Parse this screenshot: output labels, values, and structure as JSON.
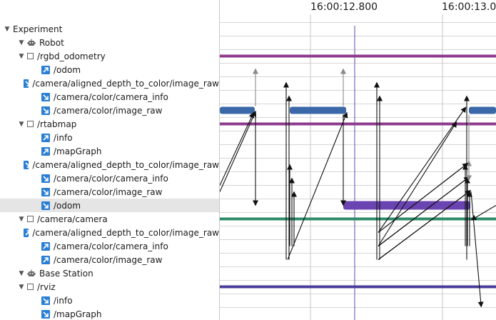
{
  "tree": [
    {
      "label": "Experiment",
      "kind": "group",
      "depth": 0
    },
    {
      "label": "Robot",
      "kind": "robot",
      "depth": 1
    },
    {
      "label": "/rgbd_odometry",
      "kind": "node",
      "depth": 2
    },
    {
      "label": "/odom",
      "kind": "pub",
      "depth": 3
    },
    {
      "label": "/camera/aligned_depth_to_color/image_raw",
      "kind": "sub",
      "depth": 3
    },
    {
      "label": "/camera/color/camera_info",
      "kind": "sub",
      "depth": 3
    },
    {
      "label": "/camera/color/image_raw",
      "kind": "sub",
      "depth": 3
    },
    {
      "label": "/rtabmap",
      "kind": "node",
      "depth": 2
    },
    {
      "label": "/info",
      "kind": "pub",
      "depth": 3
    },
    {
      "label": "/mapGraph",
      "kind": "pub",
      "depth": 3
    },
    {
      "label": "/camera/aligned_depth_to_color/image_raw",
      "kind": "sub",
      "depth": 3
    },
    {
      "label": "/camera/color/camera_info",
      "kind": "sub",
      "depth": 3
    },
    {
      "label": "/camera/color/image_raw",
      "kind": "sub",
      "depth": 3
    },
    {
      "label": "/odom",
      "kind": "sub",
      "depth": 3,
      "selected": true
    },
    {
      "label": "/camera/camera",
      "kind": "node",
      "depth": 2
    },
    {
      "label": "/camera/aligned_depth_to_color/image_raw",
      "kind": "pub",
      "depth": 3
    },
    {
      "label": "/camera/color/camera_info",
      "kind": "pub",
      "depth": 3
    },
    {
      "label": "/camera/color/image_raw",
      "kind": "pub",
      "depth": 3
    },
    {
      "label": "Base Station",
      "kind": "robot",
      "depth": 1
    },
    {
      "label": "/rviz",
      "kind": "node",
      "depth": 2
    },
    {
      "label": "/info",
      "kind": "sub",
      "depth": 3
    },
    {
      "label": "/mapGraph",
      "kind": "sub",
      "depth": 3
    }
  ],
  "timeline": {
    "ticks": [
      "16:00:12.800",
      "16:00:13.0"
    ],
    "colors": {
      "rgbd_odometry": "#8e3b8e",
      "rtabmap": "#8e3b8e",
      "camera": "#2e8b6a",
      "rviz": "#4a3c9a",
      "callback_blue": "#3a68a8",
      "callback_purple": "#6a44b0",
      "arrow_dark": "#111111",
      "arrow_grey": "#8a8a8a",
      "playhead": "#5a4ca8"
    },
    "icons": {
      "pub": "arrow-up-right-icon",
      "sub": "arrow-down-right-icon",
      "robot": "robot-icon",
      "node": "checkbox-icon"
    }
  }
}
